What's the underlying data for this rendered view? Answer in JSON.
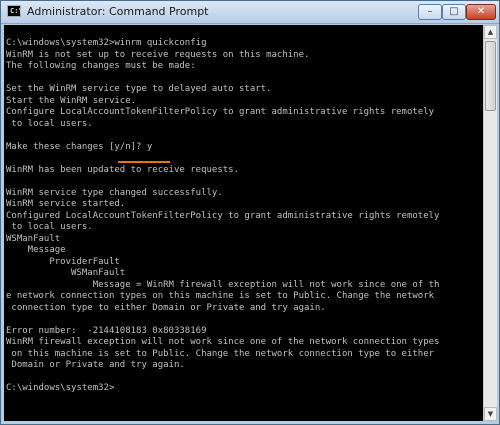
{
  "window": {
    "title": "Administrator: Command Prompt",
    "controls": {
      "minimize": "–",
      "maximize": "□",
      "close": "✕"
    }
  },
  "console": {
    "lines": [
      "C:\\windows\\system32>winrm quickconfig",
      "WinRM is not set up to receive requests on this machine.",
      "The following changes must be made:",
      "",
      "Set the WinRM service type to delayed auto start.",
      "Start the WinRM service.",
      "Configure LocalAccountTokenFilterPolicy to grant administrative rights remotely",
      " to local users.",
      "",
      "Make these changes [y/n]? y",
      "",
      "WinRM has been updated to receive requests.",
      "",
      "WinRM service type changed successfully.",
      "WinRM service started.",
      "Configured LocalAccountTokenFilterPolicy to grant administrative rights remotely",
      " to local users.",
      "WSManFault",
      "    Message",
      "        ProviderFault",
      "            WSManFault",
      "                Message = WinRM firewall exception will not work since one of th",
      "e network connection types on this machine is set to Public. Change the network",
      " connection type to either Domain or Private and try again.",
      "",
      "Error number:  -2144108183 0x80338169",
      "WinRM firewall exception will not work since one of the network connection types",
      " on this machine is set to Public. Change the network connection type to either",
      " Domain or Private and try again.",
      "",
      "C:\\windows\\system32>"
    ]
  },
  "annotation": {
    "underline_color": "#e8711a"
  },
  "colors": {
    "console_bg": "#000000",
    "console_text": "#c0c0c0"
  }
}
